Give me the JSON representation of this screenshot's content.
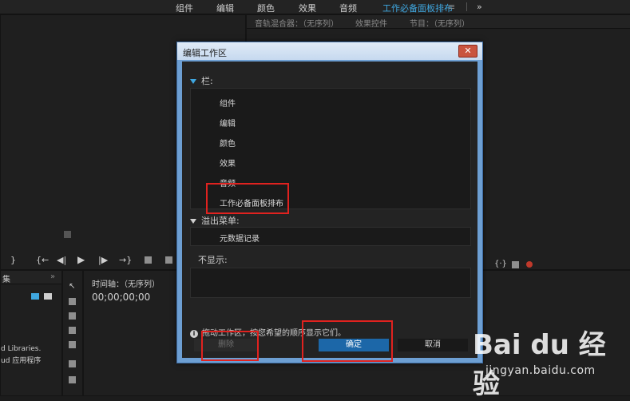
{
  "workspace_tabs": [
    "组件",
    "编辑",
    "颜色",
    "效果",
    "音频",
    "工作必备面板排布"
  ],
  "workspace_more": "»",
  "menu_glyph": "≡",
  "right_panel_tabs": [
    "音轨混合器：（无序列）",
    "效果控件",
    "节目：（无序列）"
  ],
  "timeline": {
    "tab": "时间轴：（无序列）",
    "timecode": "00;00;00;00"
  },
  "libraries": {
    "tab": "集",
    "line1": "d Libraries.",
    "line2": "ud 应用程序"
  },
  "dialog": {
    "title": "编辑工作区",
    "close_glyph": "✕",
    "bar_section": "栏:",
    "bar_items": [
      "组件",
      "编辑",
      "颜色",
      "效果",
      "音频",
      "工作必备面板排布"
    ],
    "overflow_section": "溢出菜单:",
    "overflow_items": [
      "元数据记录"
    ],
    "hidden_section": "不显示:",
    "hint": "拖动工作区，按您希望的顺序显示它们。",
    "delete_label": "删除",
    "ok_label": "确定",
    "cancel_label": "取消"
  },
  "watermark": {
    "logo": "Bai du 经验",
    "url": "jingyan.baidu.com"
  },
  "colors": {
    "accent": "#3fa7e0",
    "highlight_box": "#e0221f",
    "ok_button": "#1c67a8",
    "dialog_frame": "#6d9fd3"
  }
}
